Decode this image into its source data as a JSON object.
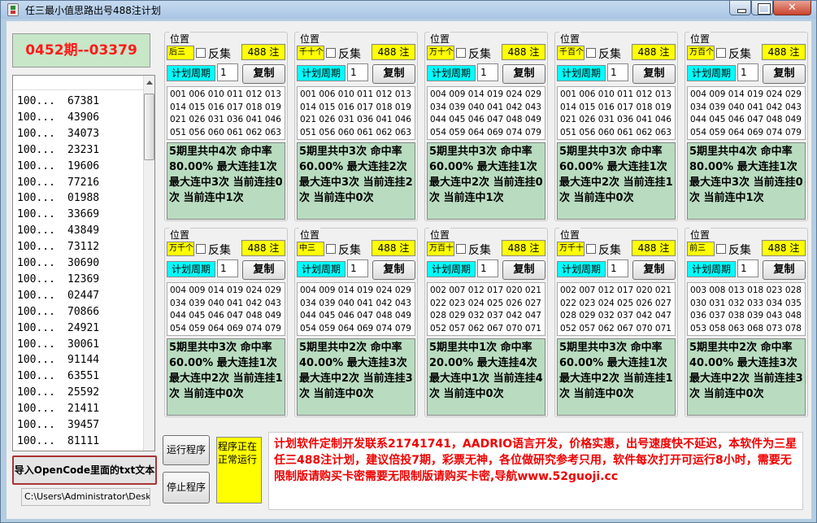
{
  "window": {
    "title": "任三最小值思路出号488注计划"
  },
  "period": {
    "label": "0452期--03379"
  },
  "history": {
    "rows": [
      [
        "100...",
        "67381"
      ],
      [
        "100...",
        "43906"
      ],
      [
        "100...",
        "34073"
      ],
      [
        "100...",
        "23231"
      ],
      [
        "100...",
        "19606"
      ],
      [
        "100...",
        "77216"
      ],
      [
        "100...",
        "01988"
      ],
      [
        "100...",
        "33669"
      ],
      [
        "100...",
        "43849"
      ],
      [
        "100...",
        "73112"
      ],
      [
        "100...",
        "30690"
      ],
      [
        "100...",
        "12369"
      ],
      [
        "100...",
        "02447"
      ],
      [
        "100...",
        "70866"
      ],
      [
        "100...",
        "24921"
      ],
      [
        "100...",
        "30061"
      ],
      [
        "100...",
        "91144"
      ],
      [
        "100...",
        "63551"
      ],
      [
        "100...",
        "25592"
      ],
      [
        "100...",
        "21411"
      ],
      [
        "100...",
        "39457"
      ],
      [
        "100...",
        "81111"
      ]
    ]
  },
  "import_button": "导入OpenCode里面的txt文本",
  "path_field": "C:\\Users\\Administrator\\Desk",
  "panels": [
    {
      "title": "位置",
      "position": "后三",
      "inverse": "反集",
      "count": "488 注",
      "cycle_label": "计划周期",
      "cycle_value": "1",
      "copy": "复制",
      "numbers": [
        "001 006 010 011 012 013",
        "014 015 016 017 018 019",
        "021 026 031 036 041 046",
        "051 056 060 061 062 063"
      ],
      "stats": "5期里共中4次 命中率80.00% 最大连挂1次 最大连中3次 当前连挂0次 当前连中1次"
    },
    {
      "title": "位置",
      "position": "千十个",
      "inverse": "反集",
      "count": "488 注",
      "cycle_label": "计划周期",
      "cycle_value": "1",
      "copy": "复制",
      "numbers": [
        "001 006 010 011 012 013",
        "014 015 016 017 018 019",
        "021 026 031 036 041 046",
        "051 056 060 061 062 063"
      ],
      "stats": "5期里共中3次 命中率60.00% 最大连挂2次 最大连中3次 当前连挂2次 当前连中0次"
    },
    {
      "title": "位置",
      "position": "万十个",
      "inverse": "反集",
      "count": "488 注",
      "cycle_label": "计划周期",
      "cycle_value": "1",
      "copy": "复制",
      "numbers": [
        "004 009 014 019 024 029",
        "034 039 040 041 042 043",
        "044 045 046 047 048 049",
        "054 059 064 069 074 079"
      ],
      "stats": "5期里共中3次 命中率60.00% 最大连挂1次 最大连中2次 当前连挂0次 当前连中1次"
    },
    {
      "title": "位置",
      "position": "千百个",
      "inverse": "反集",
      "count": "488 注",
      "cycle_label": "计划周期",
      "cycle_value": "1",
      "copy": "复制",
      "numbers": [
        "001 006 010 011 012 013",
        "014 015 016 017 018 019",
        "021 026 031 036 041 046",
        "051 056 060 061 062 063"
      ],
      "stats": "5期里共中3次 命中率60.00% 最大连挂1次 最大连中2次 当前连挂1次 当前连中0次"
    },
    {
      "title": "位置",
      "position": "万百个",
      "inverse": "反集",
      "count": "488 注",
      "cycle_label": "计划周期",
      "cycle_value": "1",
      "copy": "复制",
      "numbers": [
        "004 009 014 019 024 029",
        "034 039 040 041 042 043",
        "044 045 046 047 048 049",
        "054 059 064 069 074 079"
      ],
      "stats": "5期里共中4次 命中率80.00% 最大连挂1次 最大连中3次 当前连挂0次 当前连中1次"
    },
    {
      "title": "位置",
      "position": "万千个",
      "inverse": "反集",
      "count": "488 注",
      "cycle_label": "计划周期",
      "cycle_value": "1",
      "copy": "复制",
      "numbers": [
        "004 009 014 019 024 029",
        "034 039 040 041 042 043",
        "044 045 046 047 048 049",
        "054 059 064 069 074 079"
      ],
      "stats": "5期里共中3次 命中率60.00% 最大连挂1次 最大连中2次 当前连挂1次 当前连中0次"
    },
    {
      "title": "位置",
      "position": "中三",
      "inverse": "反集",
      "count": "488 注",
      "cycle_label": "计划周期",
      "cycle_value": "1",
      "copy": "复制",
      "numbers": [
        "004 009 014 019 024 029",
        "034 039 040 041 042 043",
        "044 045 046 047 048 049",
        "054 059 064 069 074 079"
      ],
      "stats": "5期里共中2次 命中率40.00% 最大连挂3次 最大连中2次 当前连挂3次 当前连中0次"
    },
    {
      "title": "位置",
      "position": "万百十",
      "inverse": "反集",
      "count": "488 注",
      "cycle_label": "计划周期",
      "cycle_value": "1",
      "copy": "复制",
      "numbers": [
        "002 007 012 017 020 021",
        "022 023 024 025 026 027",
        "028 029 032 037 042 047",
        "052 057 062 067 070 071"
      ],
      "stats": "5期里共中1次 命中率20.00% 最大连挂4次 最大连中1次 当前连挂4次 当前连中0次"
    },
    {
      "title": "位置",
      "position": "万千十",
      "inverse": "反集",
      "count": "488 注",
      "cycle_label": "计划周期",
      "cycle_value": "1",
      "copy": "复制",
      "numbers": [
        "002 007 012 017 020 021",
        "022 023 024 025 026 027",
        "028 029 032 037 042 047",
        "052 057 062 067 070 071"
      ],
      "stats": "5期里共中3次 命中率60.00% 最大连挂1次 最大连中2次 当前连挂1次 当前连中0次"
    },
    {
      "title": "位置",
      "position": "前三",
      "inverse": "反集",
      "count": "488 注",
      "cycle_label": "计划周期",
      "cycle_value": "1",
      "copy": "复制",
      "numbers": [
        "003 008 013 018 023 028",
        "030 031 032 033 034 035",
        "036 037 038 039 043 048",
        "053 058 063 068 073 078"
      ],
      "stats": "5期里共中2次 命中率40.00% 最大连挂3次 最大连中2次 当前连挂3次 当前连中0次"
    }
  ],
  "controls": {
    "run": "运行程序",
    "stop": "停止程序",
    "status": "程序正在正常运行"
  },
  "notice": "计划软件定制开发联系21741741，AADRIO语言开发，价格实惠，出号速度快不延迟，本软件为三星任三488注计划，建议倍投7期，彩票无神，各位做研究参考只用，软件每次打开可运行8小时，需要无限制版请购买卡密需要无限制版请购买卡密,导航www.52guoji.cc"
}
